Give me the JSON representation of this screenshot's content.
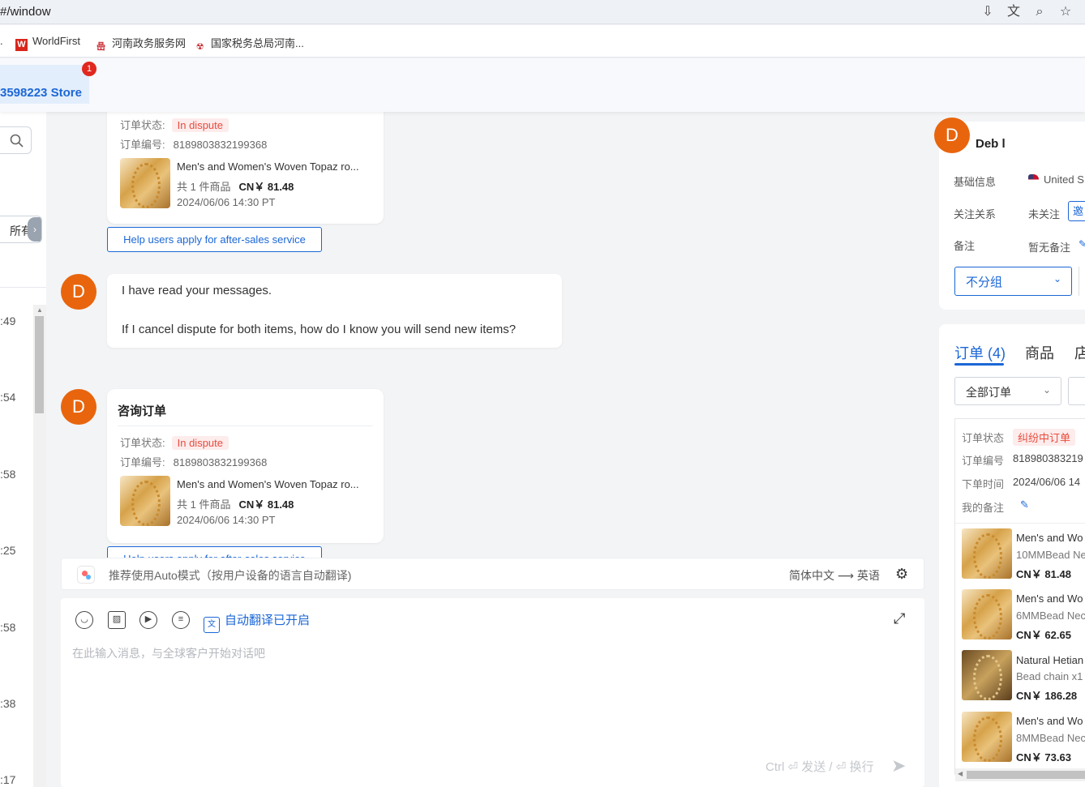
{
  "browser": {
    "url": "#/window",
    "bookmarks": [
      {
        "label": "WorldFirst",
        "icon": "W"
      },
      {
        "label": "河南政务服务网",
        "icon": "嵒"
      },
      {
        "label": "国家税务总局河南...",
        "icon": "☢"
      }
    ],
    "toolbar_icons": [
      "install-icon",
      "translate-icon",
      "zoom-icon",
      "star-icon"
    ]
  },
  "app": {
    "store_tab": "3598223 Store",
    "badge_count": "1"
  },
  "left": {
    "all_filter": "所有",
    "times": [
      ":49",
      ":54",
      ":58",
      ":25",
      ":58",
      ":38",
      ":17"
    ]
  },
  "chat": {
    "card1": {
      "status_label": "订单状态:",
      "status_value": "In dispute",
      "order_label": "订单编号:",
      "order_value": "8189803832199368",
      "product_name": "Men's and Women's Woven Topaz ro...",
      "qty": "共 1 件商品",
      "price": "CN￥ 81.48",
      "time": "2024/06/06 14:30 PT"
    },
    "after_sales_btn": "Help users apply for after-sales service",
    "avatar_letter": "D",
    "message": {
      "line1": "I have read your messages.",
      "line2": "If I cancel dispute for both items, how do I know you will send new items?"
    },
    "card2": {
      "title": "咨询订单",
      "status_label": "订单状态:",
      "status_value": "In dispute",
      "order_label": "订单编号:",
      "order_value": "8189803832199368",
      "product_name": "Men's and Women's Woven Topaz ro...",
      "qty": "共 1 件商品",
      "price": "CN￥ 81.48",
      "time": "2024/06/06 14:30 PT"
    }
  },
  "translate_bar": {
    "hint": "推荐使用Auto模式（按用户设备的语言自动翻译)",
    "lang": "简体中文 ⟶ 英语"
  },
  "composer": {
    "auto_translate": "自动翻译已开启",
    "placeholder": "在此输入消息，与全球客户开始对话吧",
    "send_hint": "Ctrl ⏎ 发送 / ⏎ 换行"
  },
  "customer": {
    "avatar_letter": "D",
    "name": "Deb l",
    "basic_label": "基础信息",
    "country": "United S",
    "follow_label": "关注关系",
    "follow_value": "未关注",
    "invite": "邀",
    "note_label": "备注",
    "note_value": "暂无备注",
    "group": "不分组"
  },
  "orders": {
    "tabs": [
      "订单 (4)",
      "商品",
      "店"
    ],
    "filter": "全部订单",
    "detail": {
      "status_label": "订单状态",
      "status_value": "纠纷中订单",
      "number_label": "订单编号",
      "number_value": "818980383219",
      "time_label": "下单时间",
      "time_value": "2024/06/06 14",
      "note_label": "我的备注"
    },
    "items": [
      {
        "title": "Men's and Wo",
        "sub": "10MMBead Ne",
        "price": "CN￥ 81.48"
      },
      {
        "title": "Men's and Wo",
        "sub": "6MMBead Nec",
        "price": "CN￥ 62.65"
      },
      {
        "title": "Natural Hetian",
        "sub": "Bead chain x1",
        "price": "CN￥ 186.28"
      },
      {
        "title": "Men's and Wo",
        "sub": "8MMBead Nec",
        "price": "CN￥ 73.63"
      }
    ]
  }
}
